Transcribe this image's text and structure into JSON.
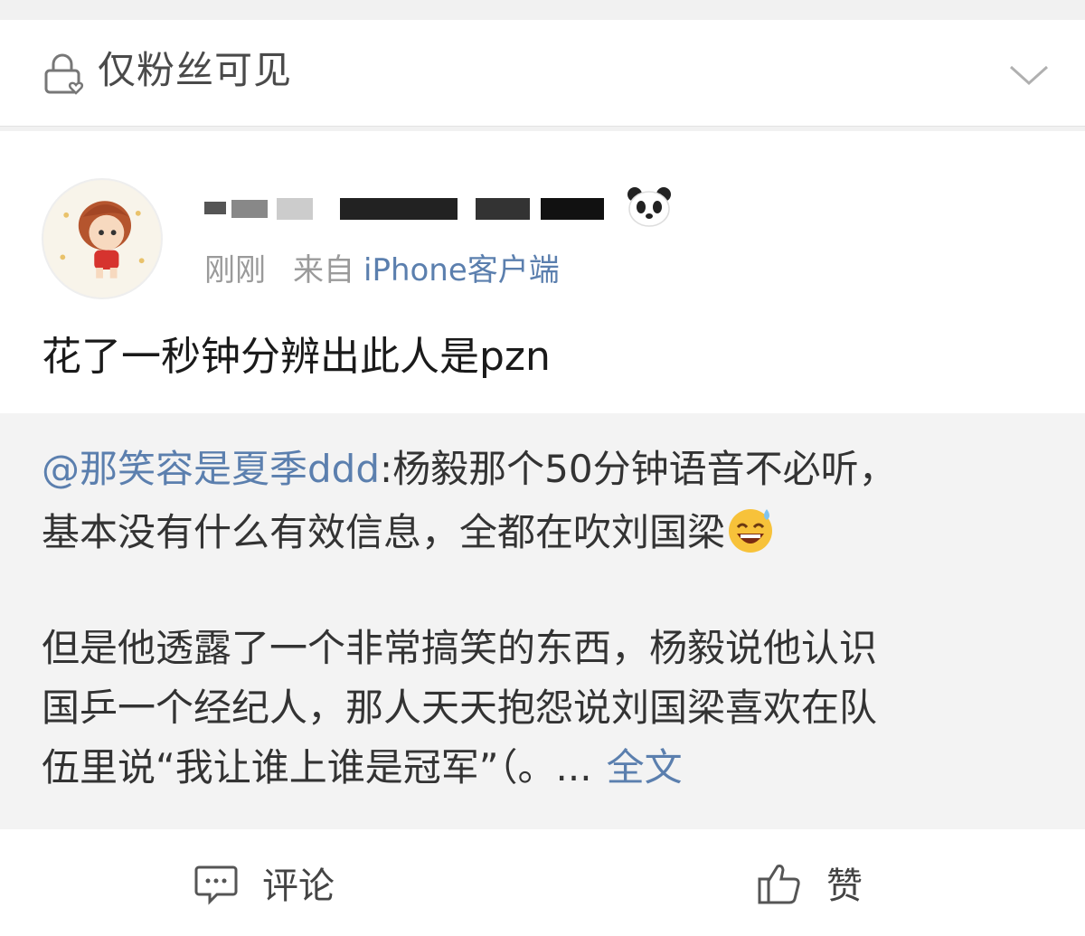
{
  "visibility": {
    "label": "仅粉丝可见",
    "lock_icon": "lock-heart-icon",
    "expand_icon": "chevron-down-icon"
  },
  "post": {
    "author": {
      "name": "",
      "badge_icon": "panda-icon",
      "avatar": "cartoon-avatar"
    },
    "time": "刚刚",
    "source_prefix": "来自",
    "source_client": "iPhone客户端",
    "text": "花了一秒钟分辨出此人是pzn"
  },
  "repost": {
    "mention": "@那笑容是夏季ddd",
    "line1_rest": ":杨毅那个50分钟语音不必听，",
    "line2": "基本没有什么有效信息，全都在吹刘国梁",
    "emoji": "grinning-sweat-emoji",
    "line3": "但是他透露了一个非常搞笑的东西，杨毅说他认识",
    "line4": "国乒一个经纪人，那人天天抱怨说刘国梁喜欢在队",
    "line5": "伍里说“我让谁上谁是冠军”（。...",
    "full_text_link": "全文"
  },
  "actions": {
    "comment_label": "评论",
    "comment_icon": "comment-icon",
    "like_label": "赞",
    "like_icon": "thumbs-up-icon"
  },
  "colors": {
    "link": "#5b7fae",
    "meta": "#9a9a9a",
    "repost_bg": "#f3f3f3"
  }
}
